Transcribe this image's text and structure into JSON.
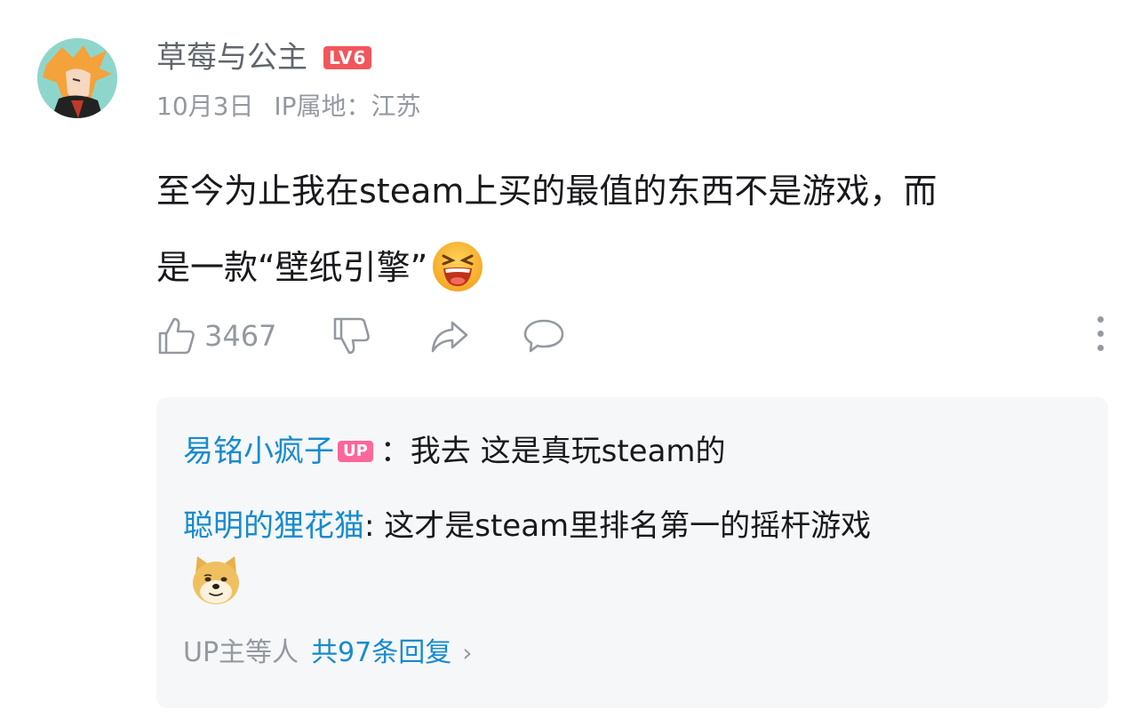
{
  "comment": {
    "username": "草莓与公主",
    "level": "LV6",
    "date": "10月3日",
    "ip_location": "IP属地：江苏",
    "text_line1": "至今为止我在steam上买的最值的东西不是游戏，而",
    "text_line2": "是一款“壁纸引擎”",
    "emoji": "laughing-emoji",
    "likes": "3467"
  },
  "replies": {
    "items": [
      {
        "author": "易铭小疯子",
        "badge": "UP",
        "text": "：我去 这是真玩steam的"
      },
      {
        "author": "聪明的狸花猫",
        "badge": "",
        "text": ": 这才是steam里排名第一的摇杆游戏",
        "emoji": "doge-emoji"
      }
    ],
    "summary_prefix": "UP主等人",
    "summary_count": "共97条回复"
  },
  "colors": {
    "link_blue": "#178bcf",
    "level_red": "#f1565c",
    "up_pink": "#ff6699",
    "muted_gray": "#9499a0",
    "reply_bg": "#f6f7f8"
  }
}
